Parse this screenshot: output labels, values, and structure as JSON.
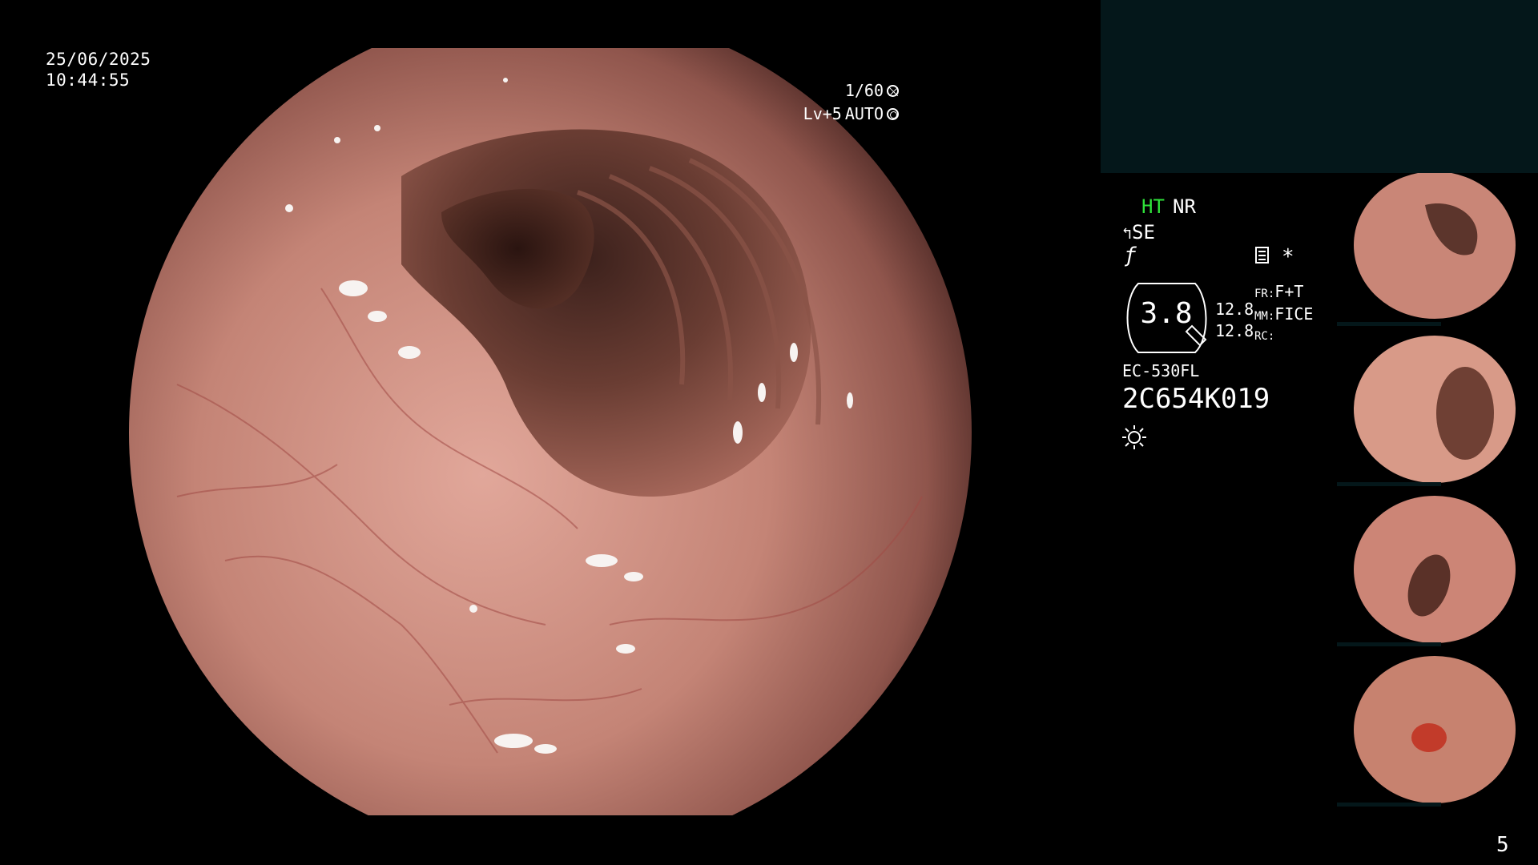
{
  "overlay": {
    "date": "25/06/2025",
    "time": "10:44:55",
    "shutter": "1/60",
    "level": "Lv+5",
    "iris_mode": "AUTO",
    "ht": "HT",
    "nr": "NR",
    "se": "SE",
    "zoom_value": "3.8",
    "zoom_line1": "12.8",
    "zoom_line2": "12.8",
    "fr_label": "FR:",
    "fr_value": "F+T",
    "mm_label": "MM:",
    "mm_value": "FICE",
    "rc_label": "RC:",
    "scope_model": "EC-530FL",
    "scope_serial": "2C654K019",
    "page_number": "5"
  },
  "icons": [
    "shutter-icon",
    "auto-iris-icon",
    "structure-enhance-icon",
    "f-icon",
    "memo-icon",
    "asterisk-icon",
    "light-icon"
  ],
  "colors": {
    "ht": "#2fe23a",
    "panel": "#04171a",
    "background": "#000000"
  },
  "thumbnails": [
    {
      "label": "thumbnail-1"
    },
    {
      "label": "thumbnail-2"
    },
    {
      "label": "thumbnail-3"
    },
    {
      "label": "thumbnail-4"
    }
  ]
}
